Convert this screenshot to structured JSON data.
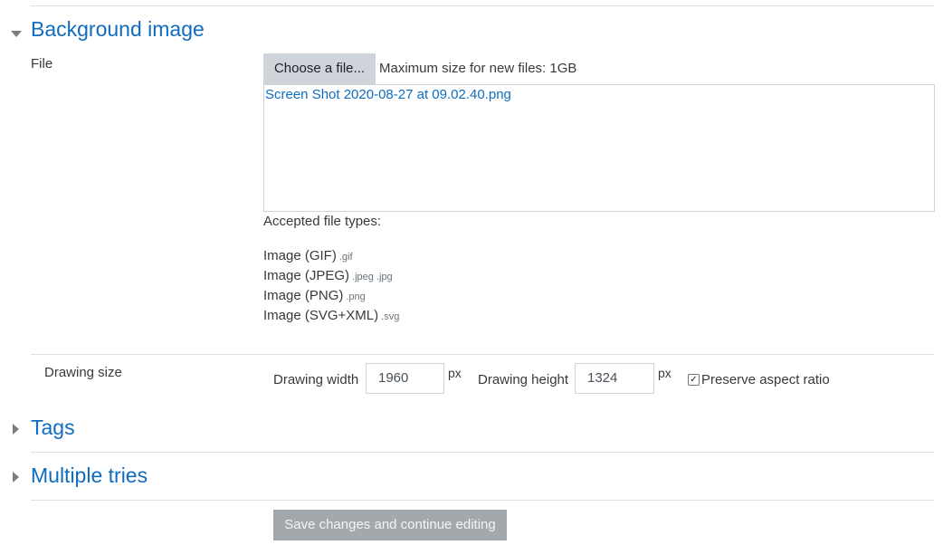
{
  "background_section": {
    "title": "Background image",
    "file_label": "File",
    "choose_button": "Choose a file...",
    "max_size": "Maximum size for new files: 1GB",
    "uploaded_file": "Screen Shot 2020-08-27 at 09.02.40.png",
    "accepted_types_label": "Accepted file types:",
    "accepted_types": [
      {
        "name": "Image (GIF)",
        "ext": ".gif"
      },
      {
        "name": "Image (JPEG)",
        "ext": ".jpeg .jpg"
      },
      {
        "name": "Image (PNG)",
        "ext": ".png"
      },
      {
        "name": "Image (SVG+XML)",
        "ext": ".svg"
      }
    ]
  },
  "drawing_size": {
    "label": "Drawing size",
    "width_label": "Drawing width",
    "width_value": "1960",
    "width_unit": "px",
    "height_label": "Drawing height",
    "height_value": "1324",
    "height_unit": "px",
    "preserve_label": "Preserve aspect ratio",
    "preserve_checked": true
  },
  "tags_section": {
    "title": "Tags"
  },
  "multiple_tries_section": {
    "title": "Multiple tries"
  },
  "footer": {
    "save_button": "Save changes and continue editing"
  },
  "colors": {
    "link": "#0f6cbf",
    "button_gray": "#ced4da",
    "disabled_button": "#a3a8ad"
  },
  "icons": {
    "expanded": "chevron-down-icon",
    "collapsed": "chevron-right-icon",
    "checkbox": "check-icon"
  }
}
